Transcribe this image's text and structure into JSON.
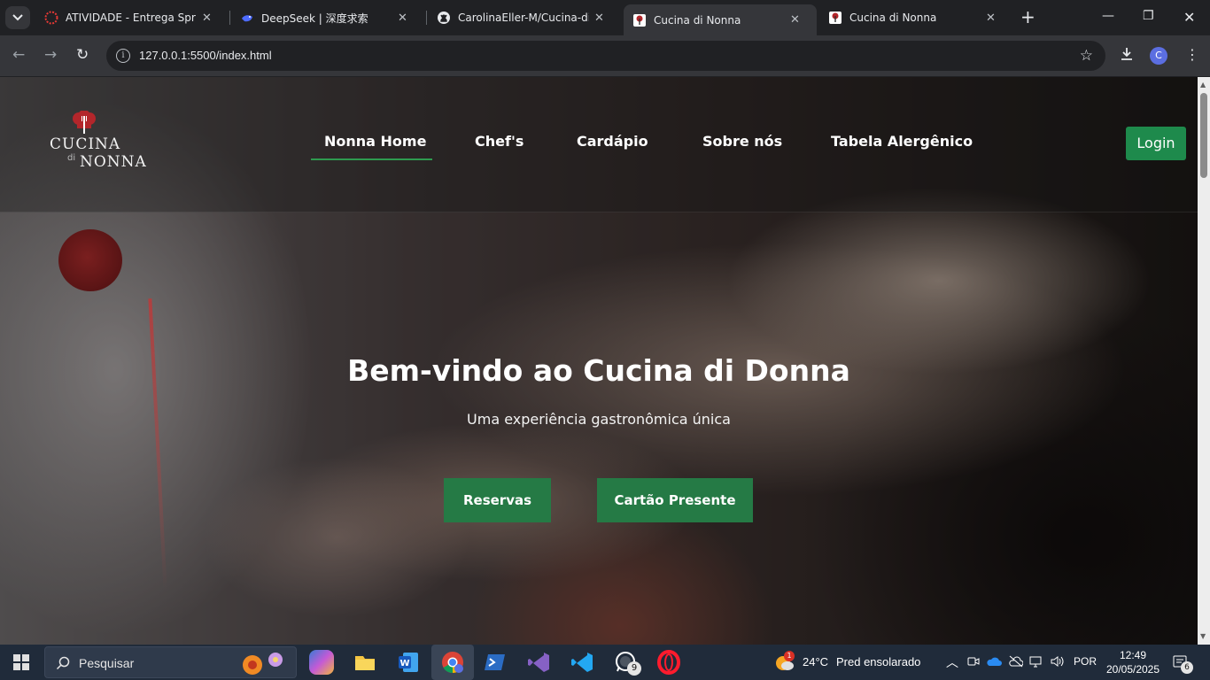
{
  "browser": {
    "tabs": [
      {
        "title": "ATIVIDADE - Entrega Sprint",
        "favicon": "sprint-favicon-icon"
      },
      {
        "title": "DeepSeek | 深度求索",
        "favicon": "deepseek-favicon-icon"
      },
      {
        "title": "CarolinaEller-M/Cucina-di-N",
        "favicon": "github-favicon-icon"
      },
      {
        "title": "Cucina di Nonna",
        "favicon": "cucina-favicon-icon",
        "active": true
      },
      {
        "title": "Cucina di Nonna",
        "favicon": "cucina-favicon-icon"
      }
    ],
    "url": "127.0.0.1:5500/index.html",
    "profile_initial": "C"
  },
  "site": {
    "logo": {
      "line1": "CUCINA",
      "line2": "NONNA",
      "connector": "di"
    },
    "nav": {
      "home": "Nonna Home",
      "chefs": "Chef's",
      "menu": "Cardápio",
      "about": "Sobre nós",
      "allergens": "Tabela Alergênico"
    },
    "login": "Login",
    "hero": {
      "title": "Bem-vindo ao Cucina di Donna",
      "subtitle": "Uma experiência gastronômica única",
      "cta_primary": "Reservas",
      "cta_secondary": "Cartão Presente"
    },
    "colors": {
      "accent": "#1e8a4c",
      "button": "#257a45",
      "brand_red": "#b3262b"
    }
  },
  "taskbar": {
    "search_placeholder": "Pesquisar",
    "whatsapp_badge": "9",
    "weather": {
      "temp": "24°C",
      "desc": "Pred ensolarado",
      "alert": "1"
    },
    "language": "POR",
    "time": "12:49",
    "date": "20/05/2025",
    "notifications": "6"
  }
}
